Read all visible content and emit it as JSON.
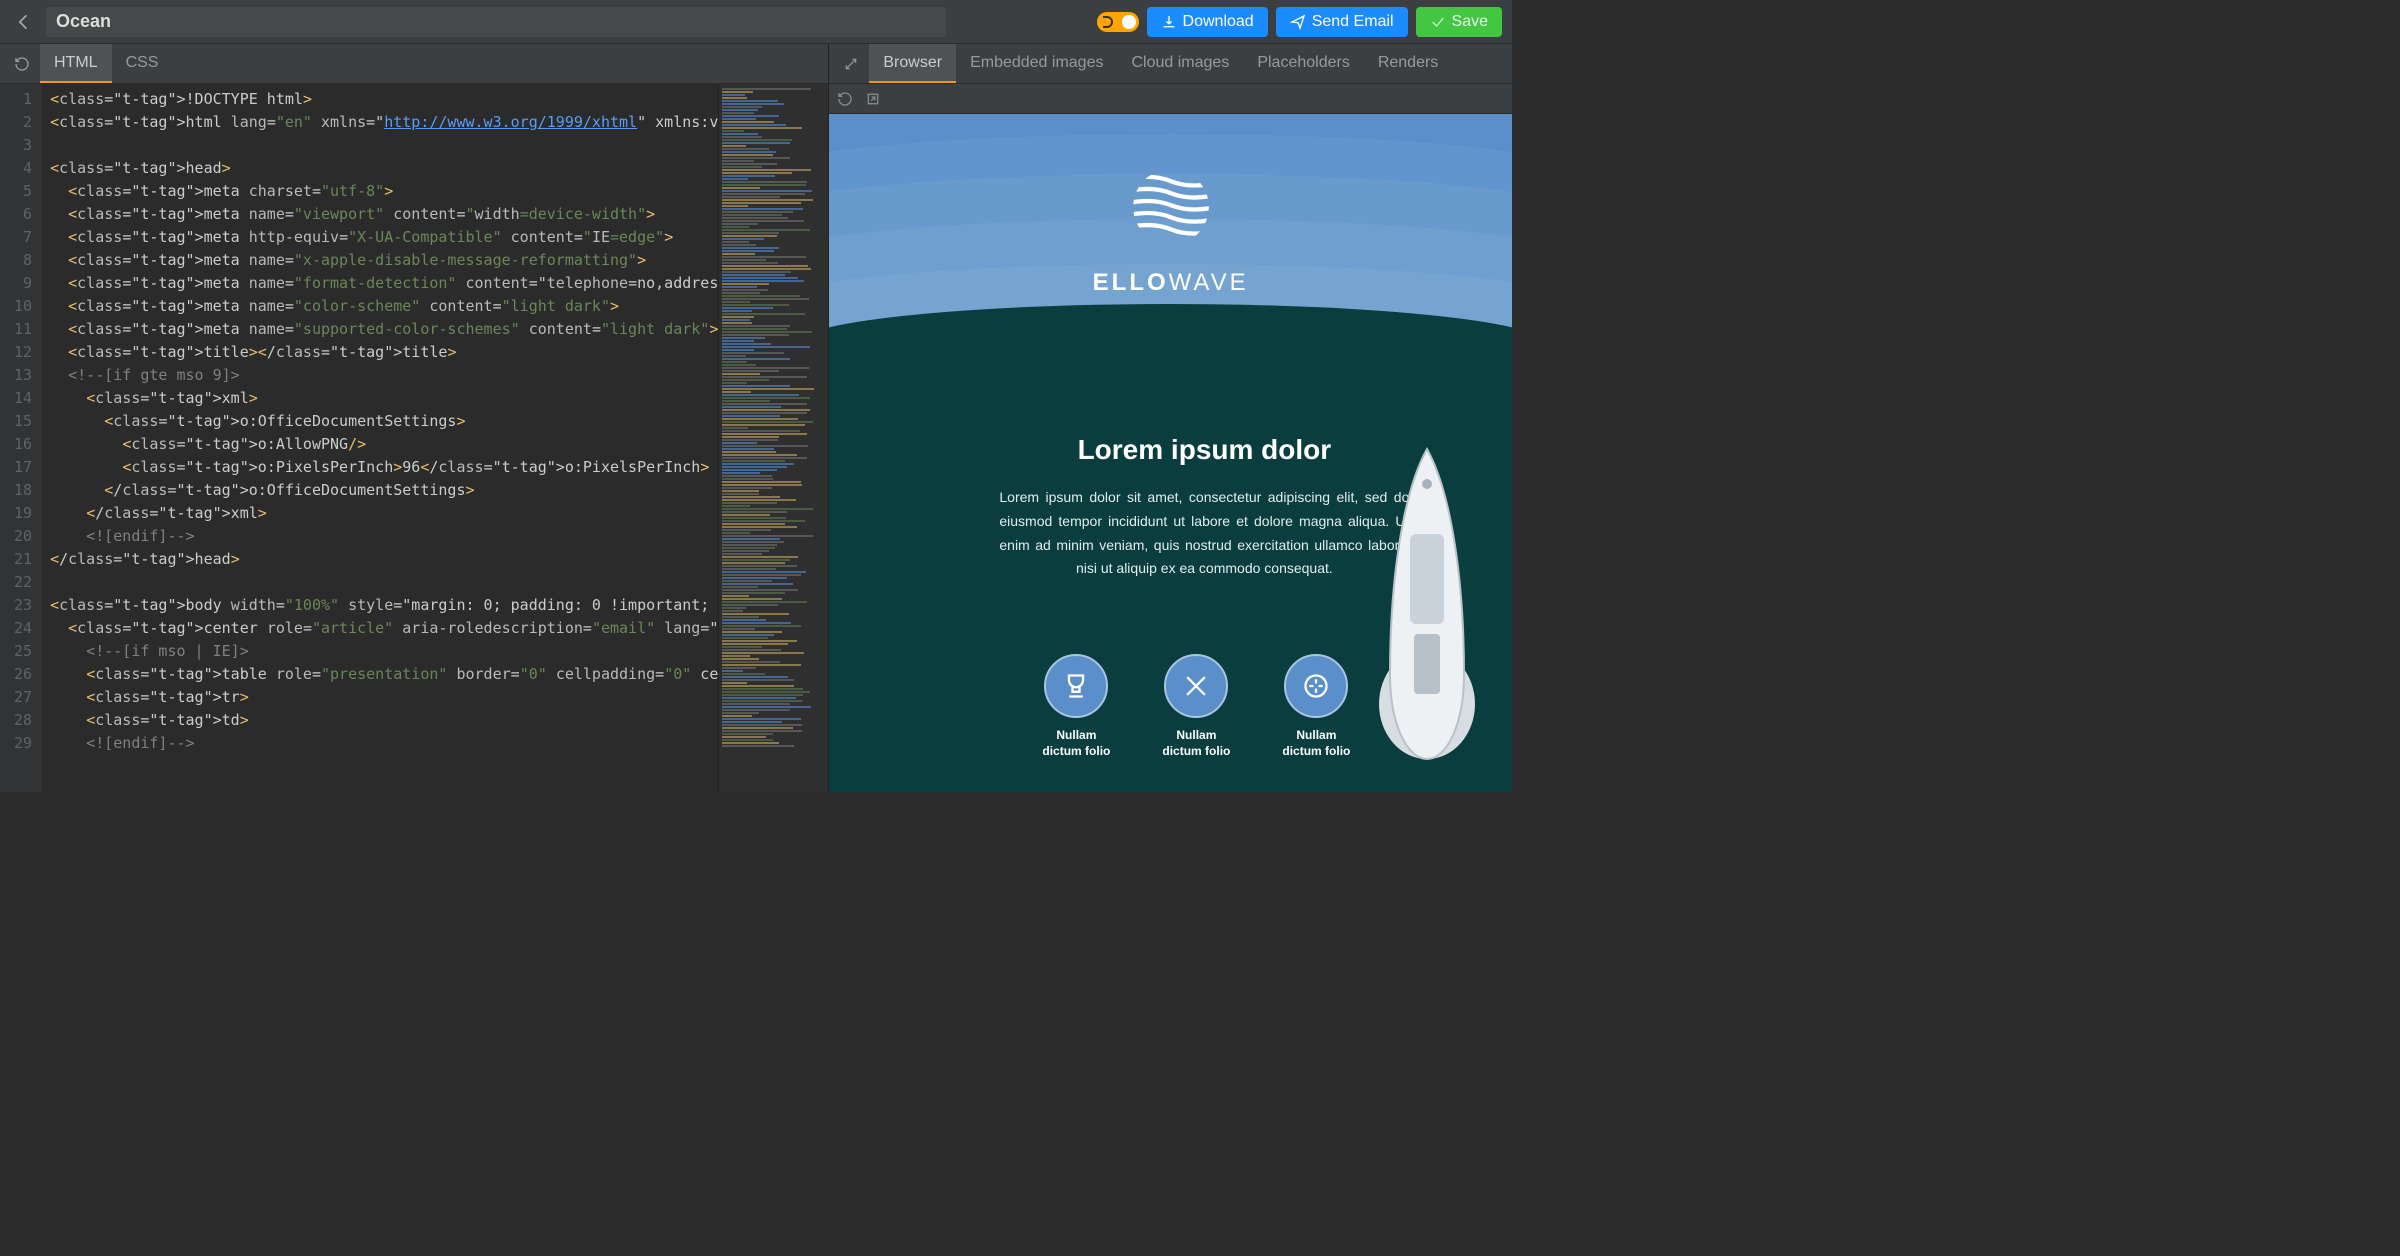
{
  "toolbar": {
    "title": "Ocean",
    "download_label": "Download",
    "send_email_label": "Send Email",
    "save_label": "Save"
  },
  "left_tabs": [
    "HTML",
    "CSS"
  ],
  "left_active_tab": 0,
  "right_tabs": [
    "Browser",
    "Embedded images",
    "Cloud images",
    "Placeholders",
    "Renders"
  ],
  "right_active_tab": 0,
  "code_lines": [
    "<!DOCTYPE html>",
    "<html lang=\"en\" xmlns=\"http://www.w3.org/1999/xhtml\" xmlns:v",
    "",
    "<head>",
    "  <meta charset=\"utf-8\">",
    "  <meta name=\"viewport\" content=\"width=device-width\">",
    "  <meta http-equiv=\"X-UA-Compatible\" content=\"IE=edge\">",
    "  <meta name=\"x-apple-disable-message-reformatting\">",
    "  <meta name=\"format-detection\" content=\"telephone=no,addres",
    "  <meta name=\"color-scheme\" content=\"light dark\">",
    "  <meta name=\"supported-color-schemes\" content=\"light dark\">",
    "  <title></title>",
    "  <!--[if gte mso 9]>",
    "    <xml>",
    "      <o:OfficeDocumentSettings>",
    "        <o:AllowPNG/>",
    "        <o:PixelsPerInch>96</o:PixelsPerInch>",
    "      </o:OfficeDocumentSettings>",
    "    </xml>",
    "    <![endif]-->",
    "</head>",
    "",
    "<body width=\"100%\" style=\"margin: 0; padding: 0 !important;",
    "  <center role=\"article\" aria-roledescription=\"email\" lang=\"",
    "    <!--[if mso | IE]>",
    "    <table role=\"presentation\" border=\"0\" cellpadding=\"0\" ce",
    "    <tr>",
    "    <td>",
    "    <![endif]-->"
  ],
  "preview": {
    "brand_bold": "ELLO",
    "brand_thin": "WAVE",
    "headline": "Lorem ipsum dolor",
    "body_text": "Lorem ipsum dolor sit amet, consectetur adipiscing elit, sed do eiusmod tempor incididunt ut labore et dolore magna aliqua. Ut enim ad minim veniam, quis nostrud exercitation ullamco laboris nisi ut aliquip ex ea commodo consequat.",
    "features": [
      {
        "label_line1": "Nullam",
        "label_line2": "dictum folio",
        "icon": "trophy"
      },
      {
        "label_line1": "Nullam",
        "label_line2": "dictum folio",
        "icon": "nodes"
      },
      {
        "label_line1": "Nullam",
        "label_line2": "dictum folio",
        "icon": "compass"
      }
    ]
  },
  "colors": {
    "accent_orange": "#ff9800",
    "btn_blue": "#1a8cff",
    "btn_green": "#43c743",
    "sky": "#5b8fc9",
    "sea": "#0a3d3d"
  }
}
